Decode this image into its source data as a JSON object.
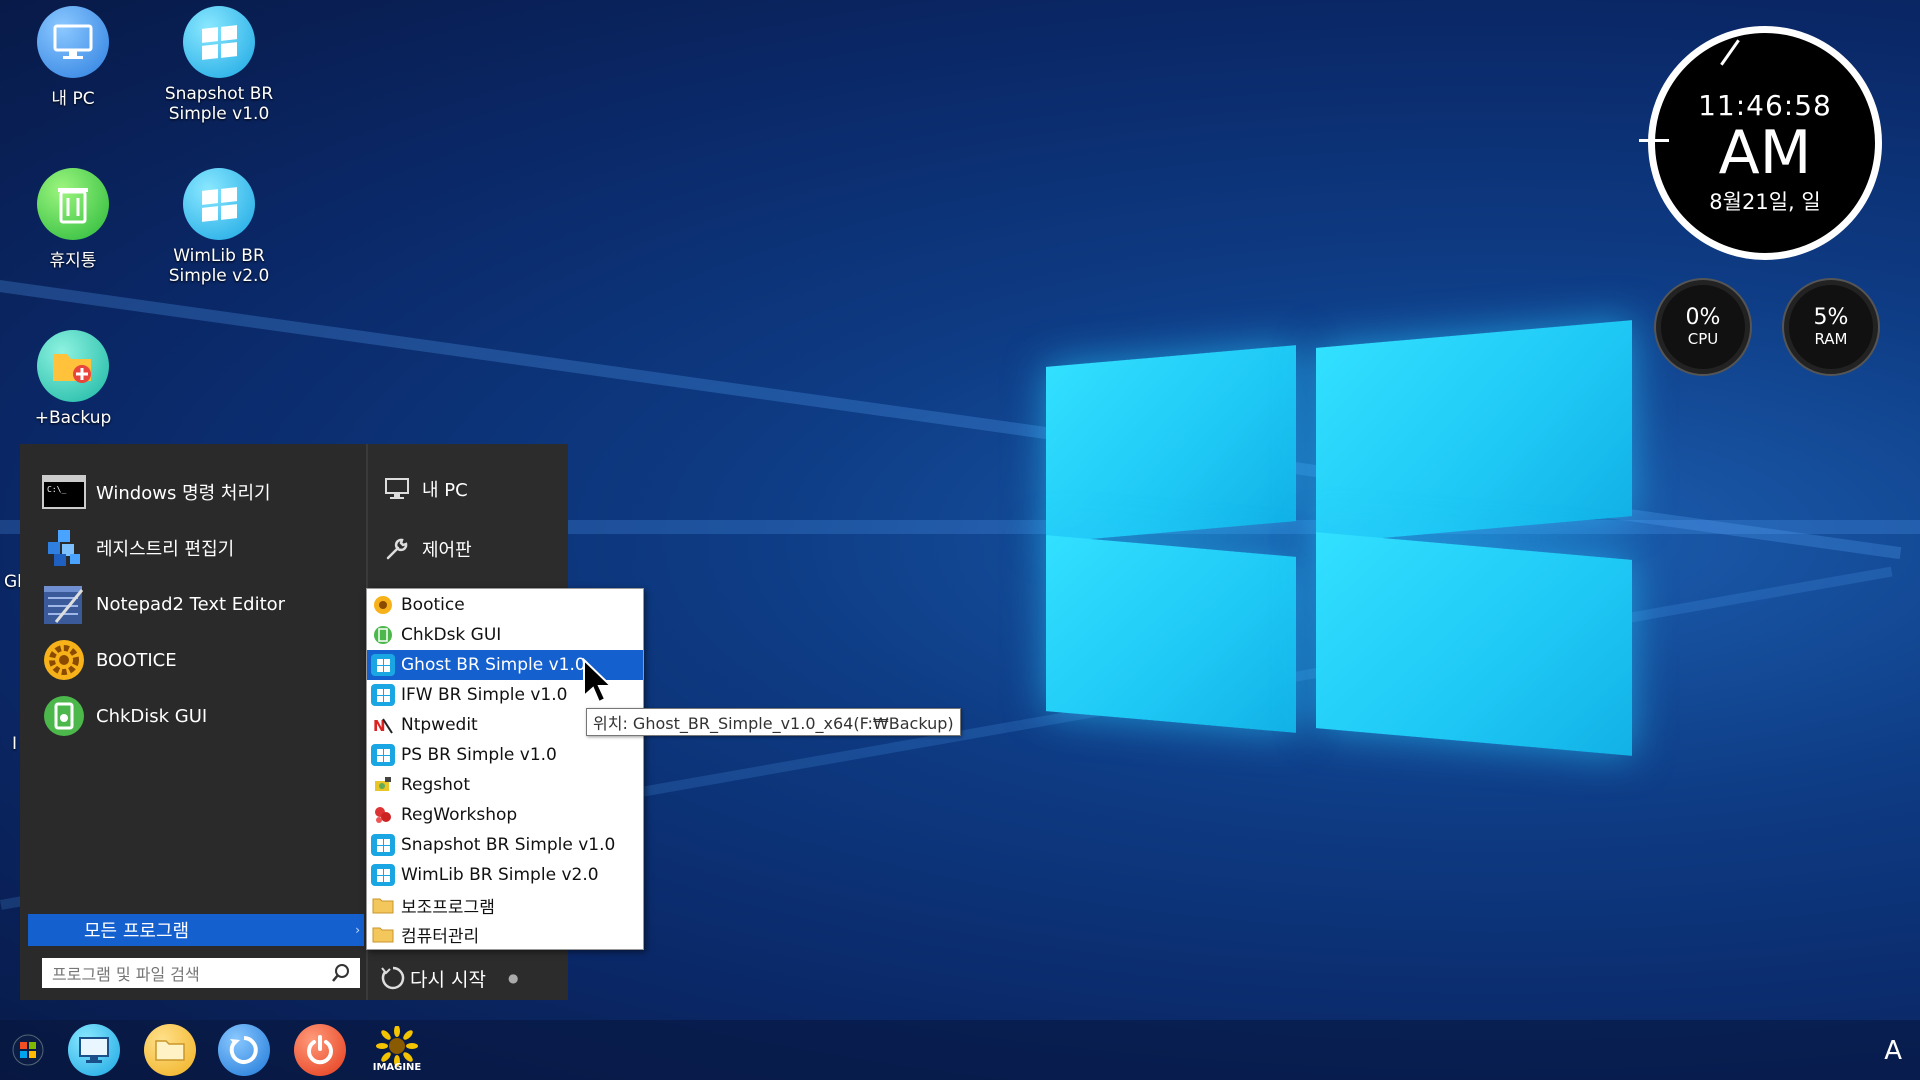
{
  "desktop": {
    "icons": [
      {
        "label": "내 PC",
        "icon": "monitor-icon"
      },
      {
        "label": "Snapshot BR\nSimple v1.0",
        "icon": "windows-logo-icon"
      },
      {
        "label": "휴지통",
        "icon": "recycle-bin-icon"
      },
      {
        "label": "WimLib BR\nSimple v2.0",
        "icon": "windows-logo-icon"
      },
      {
        "label": "+Backup",
        "icon": "folder-plus-icon"
      }
    ],
    "edge_fragments": [
      "Gl",
      "I"
    ]
  },
  "clock": {
    "time": "11:46:58",
    "ampm": "AM",
    "date": "8월21일, 일"
  },
  "gauges": [
    {
      "value": "0%",
      "label": "CPU"
    },
    {
      "value": "5%",
      "label": "RAM"
    }
  ],
  "start_menu": {
    "pinned": [
      {
        "label": "Windows 명령 처리기",
        "icon": "command-prompt-icon"
      },
      {
        "label": "레지스트리 편집기",
        "icon": "registry-editor-icon"
      },
      {
        "label": "Notepad2 Text Editor",
        "icon": "notepad-icon"
      },
      {
        "label": "BOOTICE",
        "icon": "gear-icon"
      },
      {
        "label": "ChkDisk GUI",
        "icon": "chkdsk-icon"
      }
    ],
    "all_programs_label": "모든 프로그램",
    "search_placeholder": "프로그램 및 파일 검색",
    "right_links": [
      {
        "label": "내 PC",
        "icon": "monitor-icon"
      },
      {
        "label": "제어판",
        "icon": "wrench-icon"
      }
    ],
    "restart_label": "다시 시작"
  },
  "submenu": {
    "items": [
      {
        "label": "Bootice",
        "icon": "gear-icon"
      },
      {
        "label": "ChkDsk GUI",
        "icon": "chkdsk-icon"
      },
      {
        "label": "Ghost BR Simple v1.0",
        "icon": "windows-logo-icon",
        "selected": true
      },
      {
        "label": "IFW BR Simple v1.0",
        "icon": "windows-logo-icon"
      },
      {
        "label": "Ntpwedit",
        "icon": "ntpwedit-icon"
      },
      {
        "label": "PS BR Simple v1.0",
        "icon": "windows-logo-icon"
      },
      {
        "label": "Regshot",
        "icon": "regshot-icon"
      },
      {
        "label": "RegWorkshop",
        "icon": "regworkshop-icon"
      },
      {
        "label": "Snapshot BR Simple v1.0",
        "icon": "windows-logo-icon"
      },
      {
        "label": "WimLib BR Simple v2.0",
        "icon": "windows-logo-icon"
      },
      {
        "label": "보조프로그램",
        "icon": "folder-icon"
      },
      {
        "label": "컴퓨터관리",
        "icon": "folder-icon"
      }
    ],
    "tooltip": "위치: Ghost_BR_Simple_v1.0_x64(F:₩Backup)"
  },
  "taskbar": {
    "items": [
      {
        "icon": "start-orb-icon"
      },
      {
        "icon": "monitor-icon"
      },
      {
        "icon": "folder-icon"
      },
      {
        "icon": "refresh-icon"
      },
      {
        "icon": "power-icon"
      },
      {
        "icon": "imagine-icon",
        "text": "IMAGINE"
      }
    ],
    "language": "A"
  },
  "colors": {
    "accent": "#1560cf",
    "menu_bg": "#2a2a2a",
    "desktop_bg": "#0e3c85"
  }
}
